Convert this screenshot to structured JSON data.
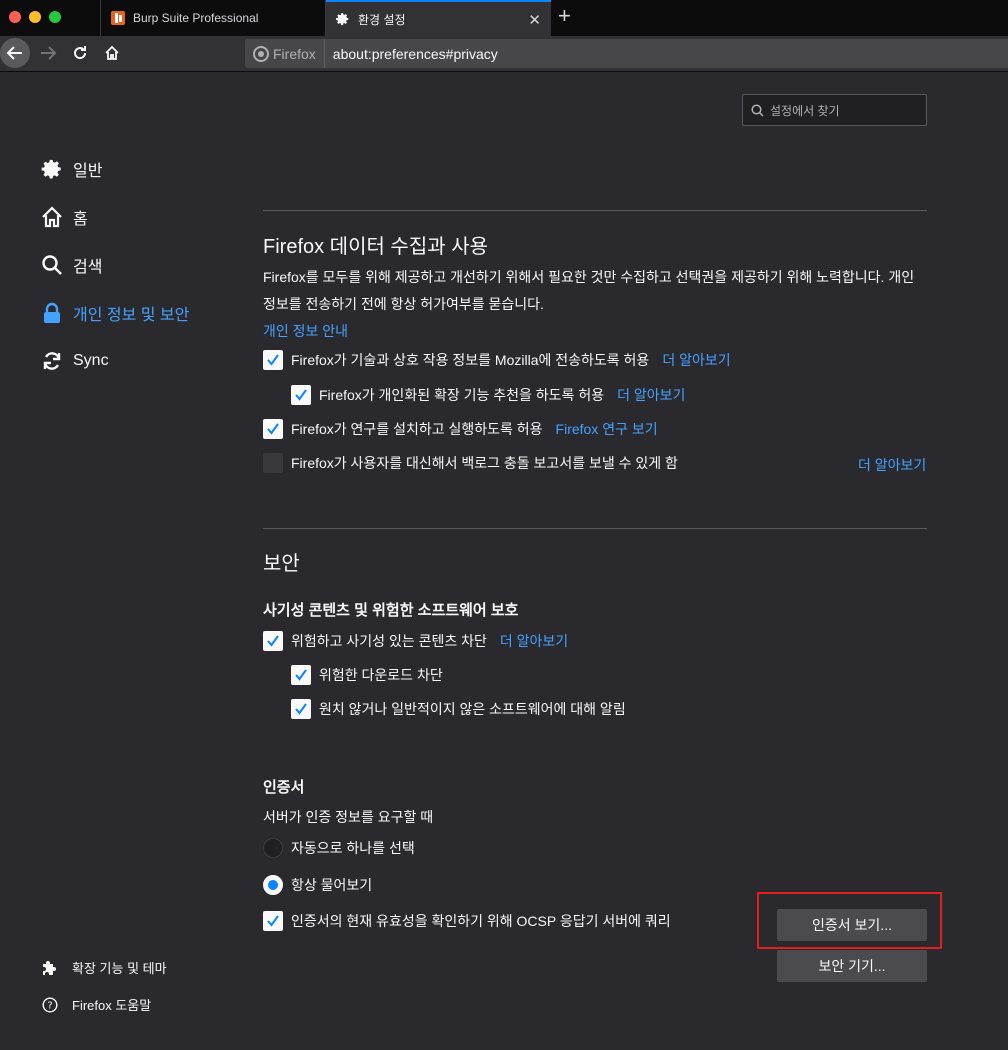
{
  "tabs": [
    {
      "label": "Burp Suite Professional"
    },
    {
      "label": "환경 설정"
    }
  ],
  "urlbar": {
    "identity": "Firefox",
    "url": "about:preferences#privacy"
  },
  "search": {
    "placeholder": "설정에서 찾기"
  },
  "sidebar": {
    "items": [
      {
        "label": "일반"
      },
      {
        "label": "홈"
      },
      {
        "label": "검색"
      },
      {
        "label": "개인 정보 및 보안"
      },
      {
        "label": "Sync"
      }
    ],
    "bottom": [
      {
        "label": "확장 기능 및 테마"
      },
      {
        "label": "Firefox 도움말"
      }
    ]
  },
  "data_collection": {
    "title": "Firefox 데이터 수집과 사용",
    "description": "Firefox를 모두를 위해 제공하고 개선하기 위해서 필요한 것만 수집하고 선택권을 제공하기 위해 노력합니다. 개인 정보를 전송하기 전에 항상 허가여부를 묻습니다.",
    "privacy_link": "개인 정보 안내",
    "options": [
      {
        "label": "Firefox가 기술과 상호 작용 정보를 Mozilla에 전송하도록 허용",
        "link": "더 알아보기",
        "checked": true
      },
      {
        "label": "Firefox가 개인화된 확장 기능 추천을 하도록 허용",
        "link": "더 알아보기",
        "checked": true
      },
      {
        "label": "Firefox가 연구를 설치하고 실행하도록 허용",
        "link": "Firefox 연구 보기",
        "checked": true
      },
      {
        "label": "Firefox가 사용자를 대신해서 백로그 충돌 보고서를 보낼 수 있게 함",
        "link": "더 알아보기",
        "checked": false
      }
    ]
  },
  "security": {
    "title": "보안",
    "deceptive": {
      "title": "사기성 콘텐츠 및 위험한 소프트웨어 보호",
      "options": [
        {
          "label": "위험하고 사기성 있는 콘텐츠 차단",
          "link": "더 알아보기",
          "checked": true
        },
        {
          "label": "위험한 다운로드 차단",
          "checked": true
        },
        {
          "label": "원치 않거나 일반적이지 않은 소프트웨어에 대해 알림",
          "checked": true
        }
      ]
    },
    "certificates": {
      "title": "인증서",
      "subtitle": "서버가 인증 정보를 요구할 때",
      "radios": [
        {
          "label": "자동으로 하나를 선택",
          "selected": false
        },
        {
          "label": "항상 물어보기",
          "selected": true
        }
      ],
      "ocsp": {
        "label": "인증서의 현재 유효성을 확인하기 위해 OCSP 응답기 서버에 쿼리",
        "checked": true
      },
      "view_button": "인증서 보기...",
      "devices_button": "보안 기기..."
    }
  },
  "colors": {
    "accent": "#0a84ff",
    "link": "#45a1ff",
    "highlight": "#e31e1e",
    "background": "#2a2a2e"
  }
}
